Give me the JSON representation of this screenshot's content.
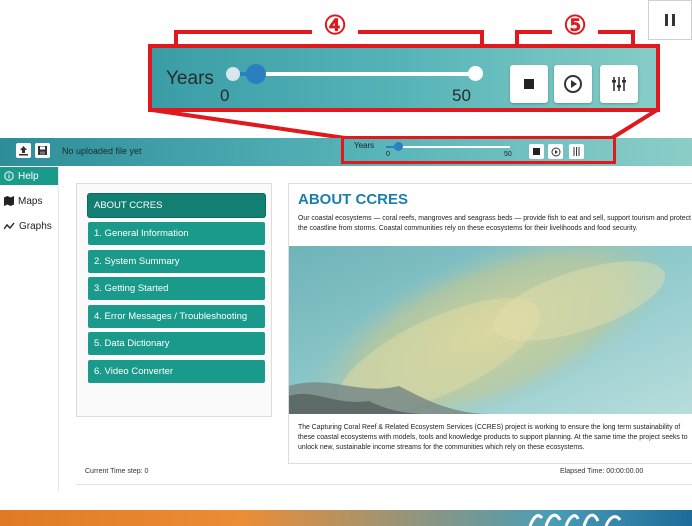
{
  "callout": {
    "years_label": "Years",
    "min_label": "0",
    "max_label": "50",
    "marker_4": "④",
    "marker_5": "⑤",
    "slider_value": 0.04
  },
  "header": {
    "file_status": "No uploaded file yet",
    "years_label": "Years",
    "min_label": "0",
    "max_label": "50"
  },
  "nav": {
    "items": [
      {
        "label": "Help",
        "icon": "info-icon"
      },
      {
        "label": "Maps",
        "icon": "map-icon"
      },
      {
        "label": "Graphs",
        "icon": "chart-line-icon"
      }
    ]
  },
  "toc": {
    "items": [
      "ABOUT CCRES",
      "1. General Information",
      "2. System Summary",
      "3. Getting Started",
      "4. Error Messages / Troubleshooting",
      "5. Data Dictionary",
      "6. Video Converter"
    ]
  },
  "doc": {
    "title": "ABOUT CCRES",
    "para1": "Our coastal ecosystems — coral reefs, mangroves and seagrass beds — provide fish to eat and sell, support tourism and protect the coastline from storms. Coastal communities rely on these ecosystems for their livelihoods and food security.",
    "para2": "The Capturing Coral Reef & Related Ecosystem Services (CCRES) project is working to ensure the long term sustainability of these coastal ecosystems with models, tools and knowledge products to support planning. At the same time the project seeks to unlock new, sustainable income streams for the communities which rely on these ecosystems."
  },
  "status": {
    "time_step": "Current Time step: 0",
    "elapsed": "Elapsed Time: 00:00:00.00"
  },
  "colors": {
    "accent": "#199a8a",
    "highlight": "#e0191e",
    "title_blue": "#1a7fae",
    "slider_blue": "#2b7fc0"
  }
}
